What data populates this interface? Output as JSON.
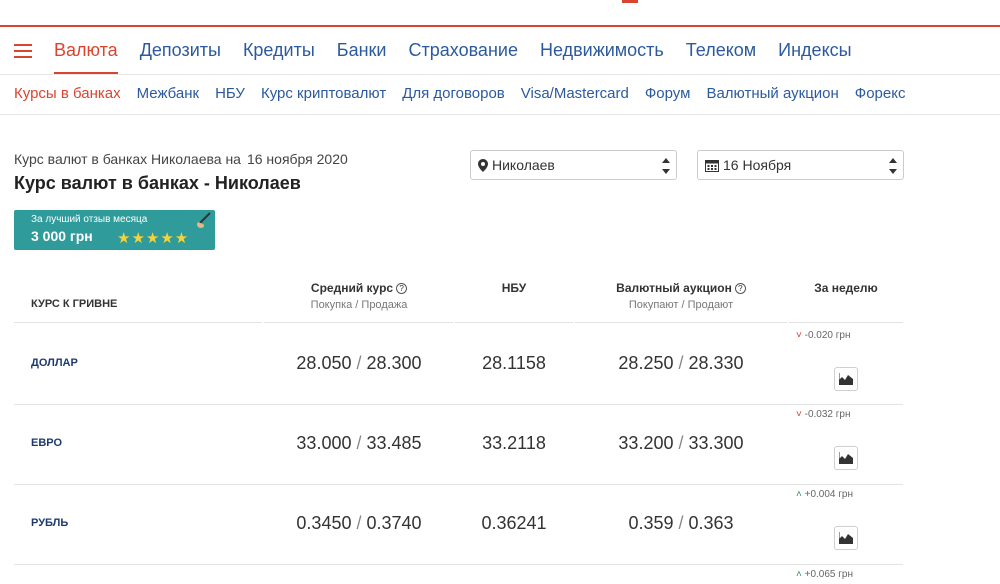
{
  "main_nav": {
    "items": [
      "Валюта",
      "Депозиты",
      "Кредиты",
      "Банки",
      "Страхование",
      "Недвижимость",
      "Телеком",
      "Индексы"
    ],
    "active": "Валюта"
  },
  "sub_nav": {
    "items": [
      "Курсы в банках",
      "Межбанк",
      "НБУ",
      "Курс криптовалют",
      "Для договоров",
      "Visa/Mastercard",
      "Форум",
      "Валютный аукцион",
      "Форекс"
    ],
    "active": "Курсы в банках"
  },
  "header": {
    "subtitle": "Курс валют в банках Николаева на",
    "subtitle_date": "16 ноября 2020",
    "title": "Курс валют в банках - Николаев"
  },
  "filters": {
    "city": "Николаев",
    "date": "16 Ноября"
  },
  "promo": {
    "line1": "За лучший отзыв месяца",
    "line2": "3 000 грн",
    "stars": "★★★★★"
  },
  "table": {
    "col_currency": "КУРС К ГРИВНЕ",
    "col_avg": "Средний курс",
    "col_avg_sub": "Покупка / Продажа",
    "col_nbu": "НБУ",
    "col_auction": "Валютный аукцион",
    "col_auction_sub": "Покупают / Продают",
    "col_week": "За неделю",
    "rows": [
      {
        "currency": "ДОЛЛАР",
        "avg_buy": "28.050",
        "avg_sell": "28.300",
        "nbu": "28.1158",
        "auc_buy": "28.250",
        "auc_sell": "28.330",
        "week_delta": "-0.020 грн",
        "week_dir": "down"
      },
      {
        "currency": "ЕВРО",
        "avg_buy": "33.000",
        "avg_sell": "33.485",
        "nbu": "33.2118",
        "auc_buy": "33.200",
        "auc_sell": "33.300",
        "week_delta": "-0.032 грн",
        "week_dir": "down"
      },
      {
        "currency": "РУБЛЬ",
        "avg_buy": "0.3450",
        "avg_sell": "0.3740",
        "nbu": "0.36241",
        "auc_buy": "0.359",
        "auc_sell": "0.363",
        "week_delta": "+0.004 грн",
        "week_dir": "up"
      }
    ],
    "next_row_delta": "+0.065 грн"
  },
  "colors": {
    "accent": "#d9452f",
    "link": "#2c5a9e",
    "promo": "#2f9b9a",
    "down": "#d23a2a",
    "up": "#2a9a45"
  }
}
